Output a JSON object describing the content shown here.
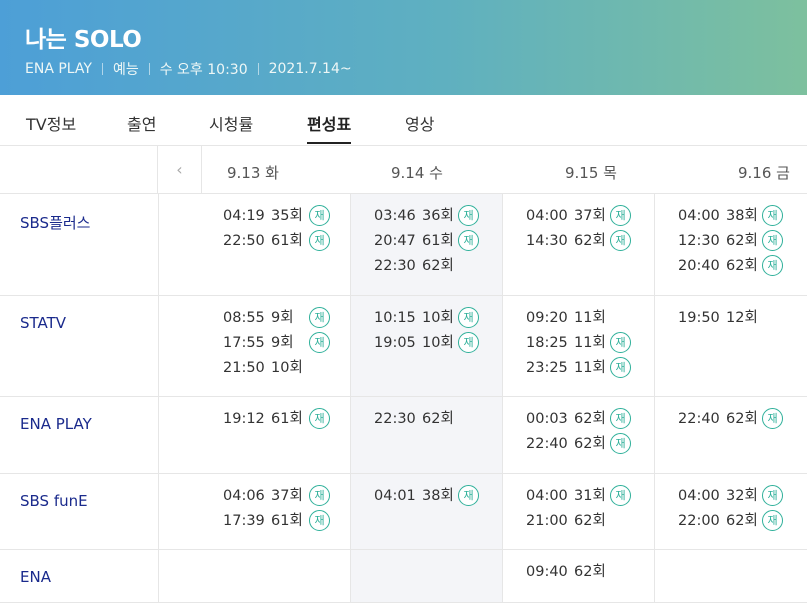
{
  "hero": {
    "title": "나는 SOLO",
    "channel": "ENA PLAY",
    "genre": "예능",
    "airtime": "수 오후 10:30",
    "start_date": "2021.7.14~"
  },
  "tabs": [
    "TV정보",
    "출연",
    "시청률",
    "편성표",
    "영상"
  ],
  "active_tab": "편성표",
  "prev_icon": "‹",
  "days": [
    "9.13 화",
    "9.14 수",
    "9.15 목",
    "9.16 금"
  ],
  "rerun_label": "재",
  "accent_color": "#2fb09a",
  "schedule": [
    {
      "channel": "SBS플러스",
      "days": [
        [
          {
            "time": "04:19",
            "ep": "35회",
            "rerun": true
          },
          {
            "time": "22:50",
            "ep": "61회",
            "rerun": true
          }
        ],
        [
          {
            "time": "03:46",
            "ep": "36회",
            "rerun": true
          },
          {
            "time": "20:47",
            "ep": "61회",
            "rerun": true
          },
          {
            "time": "22:30",
            "ep": "62회",
            "rerun": false
          }
        ],
        [
          {
            "time": "04:00",
            "ep": "37회",
            "rerun": true
          },
          {
            "time": "14:30",
            "ep": "62회",
            "rerun": true
          }
        ],
        [
          {
            "time": "04:00",
            "ep": "38회",
            "rerun": true
          },
          {
            "time": "12:30",
            "ep": "62회",
            "rerun": true
          },
          {
            "time": "20:40",
            "ep": "62회",
            "rerun": true
          }
        ]
      ]
    },
    {
      "channel": "STATV",
      "days": [
        [
          {
            "time": "08:55",
            "ep": "9회",
            "rerun": true
          },
          {
            "time": "17:55",
            "ep": "9회",
            "rerun": true
          },
          {
            "time": "21:50",
            "ep": "10회",
            "rerun": false
          }
        ],
        [
          {
            "time": "10:15",
            "ep": "10회",
            "rerun": true
          },
          {
            "time": "19:05",
            "ep": "10회",
            "rerun": true
          }
        ],
        [
          {
            "time": "09:20",
            "ep": "11회",
            "rerun": false
          },
          {
            "time": "18:25",
            "ep": "11회",
            "rerun": true
          },
          {
            "time": "23:25",
            "ep": "11회",
            "rerun": true
          }
        ],
        [
          {
            "time": "19:50",
            "ep": "12회",
            "rerun": false
          }
        ]
      ]
    },
    {
      "channel": "ENA PLAY",
      "days": [
        [
          {
            "time": "19:12",
            "ep": "61회",
            "rerun": true
          }
        ],
        [
          {
            "time": "22:30",
            "ep": "62회",
            "rerun": false
          }
        ],
        [
          {
            "time": "00:03",
            "ep": "62회",
            "rerun": true
          },
          {
            "time": "22:40",
            "ep": "62회",
            "rerun": true
          }
        ],
        [
          {
            "time": "22:40",
            "ep": "62회",
            "rerun": true
          }
        ]
      ]
    },
    {
      "channel": "SBS funE",
      "days": [
        [
          {
            "time": "04:06",
            "ep": "37회",
            "rerun": true
          },
          {
            "time": "17:39",
            "ep": "61회",
            "rerun": true
          }
        ],
        [
          {
            "time": "04:01",
            "ep": "38회",
            "rerun": true
          }
        ],
        [
          {
            "time": "04:00",
            "ep": "31회",
            "rerun": true
          },
          {
            "time": "21:00",
            "ep": "62회",
            "rerun": false
          }
        ],
        [
          {
            "time": "04:00",
            "ep": "32회",
            "rerun": true
          },
          {
            "time": "22:00",
            "ep": "62회",
            "rerun": true
          }
        ]
      ]
    },
    {
      "channel": "ENA",
      "days": [
        [],
        [],
        [
          {
            "time": "09:40",
            "ep": "62회",
            "rerun": false
          }
        ],
        []
      ]
    }
  ]
}
